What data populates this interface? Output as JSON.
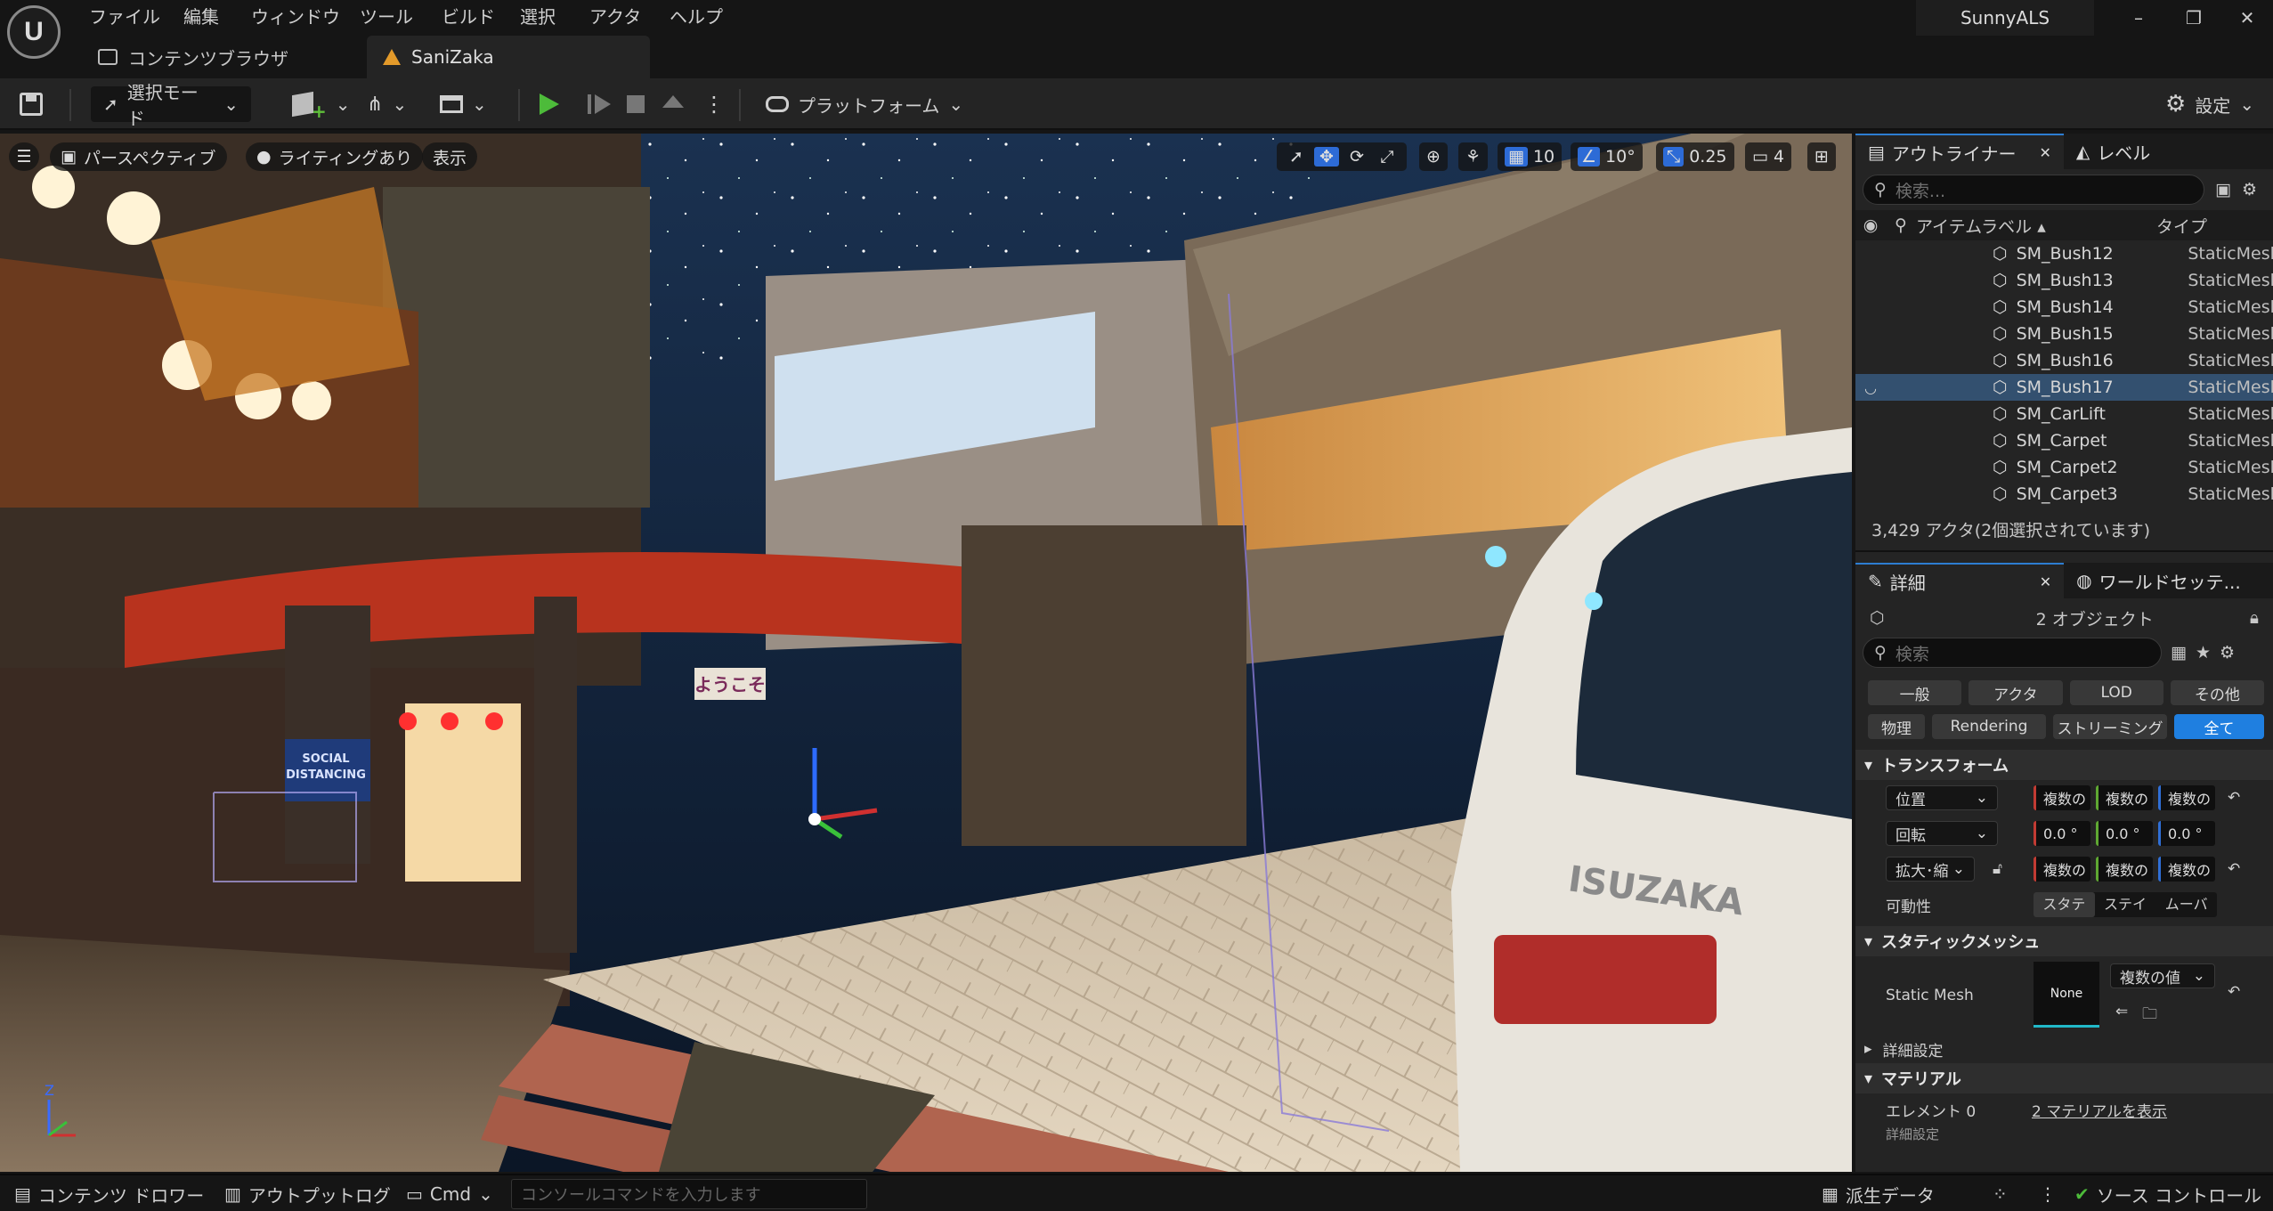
{
  "app": {
    "logo": "U",
    "project": "SunnyALS"
  },
  "menu": [
    "ファイル",
    "編集",
    "ウィンドウ",
    "ツール",
    "ビルド",
    "選択",
    "アクタ",
    "ヘルプ"
  ],
  "tabs": {
    "content_browser": "コンテンツブラウザ",
    "level": "SaniZaka"
  },
  "window_controls": {
    "minimize": "–",
    "maximize": "❐",
    "close": "✕"
  },
  "toolbar": {
    "select_mode": "選択モード",
    "platform": "プラットフォーム",
    "settings": "設定"
  },
  "viewport": {
    "perspective": "パースペクティブ",
    "lighting": "ライティングあり",
    "show": "表示",
    "grid_snap": "10",
    "rotate_snap": "10°",
    "scale_snap": "0.25",
    "camera_speed": "4",
    "axis_z": "Z"
  },
  "outliner": {
    "tab": "アウトライナー",
    "tab_level": "レベル",
    "search_placeholder": "検索...",
    "col_label": "アイテムラベル ▴",
    "col_type": "タイプ",
    "items": [
      {
        "name": "SM_Bush12",
        "type": "StaticMesh"
      },
      {
        "name": "SM_Bush13",
        "type": "StaticMesh"
      },
      {
        "name": "SM_Bush14",
        "type": "StaticMesh"
      },
      {
        "name": "SM_Bush15",
        "type": "StaticMesh"
      },
      {
        "name": "SM_Bush16",
        "type": "StaticMesh"
      },
      {
        "name": "SM_Bush17",
        "type": "StaticMesh"
      },
      {
        "name": "SM_CarLift",
        "type": "StaticMesh"
      },
      {
        "name": "SM_Carpet",
        "type": "StaticMesh"
      },
      {
        "name": "SM_Carpet2",
        "type": "StaticMesh"
      },
      {
        "name": "SM_Carpet3",
        "type": "StaticMesh"
      }
    ],
    "selected_index": 5,
    "count": "3,429 アクタ(2個選択されています)"
  },
  "details": {
    "tab": "詳細",
    "tab_world": "ワールドセッテ...",
    "object_count": "2 オブジェクト",
    "search_placeholder": "検索",
    "filters_row1": [
      "一般",
      "アクタ",
      "LOD",
      "その他"
    ],
    "filters_row2": [
      "物理",
      "Rendering",
      "ストリーミング",
      "全て"
    ],
    "section_transform": "トランスフォーム",
    "location": "位置",
    "rotation": "回転",
    "scale": "拡大･縮",
    "multi": "複数の",
    "rot_x": "0.0 °",
    "rot_y": "0.0 °",
    "rot_z": "0.0 °",
    "mobility": "可動性",
    "mob_static": "スタテ",
    "mob_stationary": "ステイ",
    "mob_movable": "ムーバ",
    "section_static_mesh": "スタティックメッシュ",
    "static_mesh": "Static Mesh",
    "mesh_none": "None",
    "multi_values": "複数の値",
    "advanced": "詳細設定",
    "section_material": "マテリアル",
    "element0": "エレメント 0",
    "show_materials": "2 マテリアルを表示",
    "advanced2": "詳細設定"
  },
  "statusbar": {
    "content_drawer": "コンテンツ ドロワー",
    "output_log": "アウトプットログ",
    "cmd": "Cmd",
    "console_placeholder": "コンソールコマンドを入力します",
    "derived_data": "派生データ",
    "source_control": "ソース コントロール"
  },
  "scene_signs": {
    "social": "SOCIAL",
    "distancing": "DISTANCING",
    "youkoso": "ようこそ",
    "car_brand": "ISUZAKA"
  }
}
